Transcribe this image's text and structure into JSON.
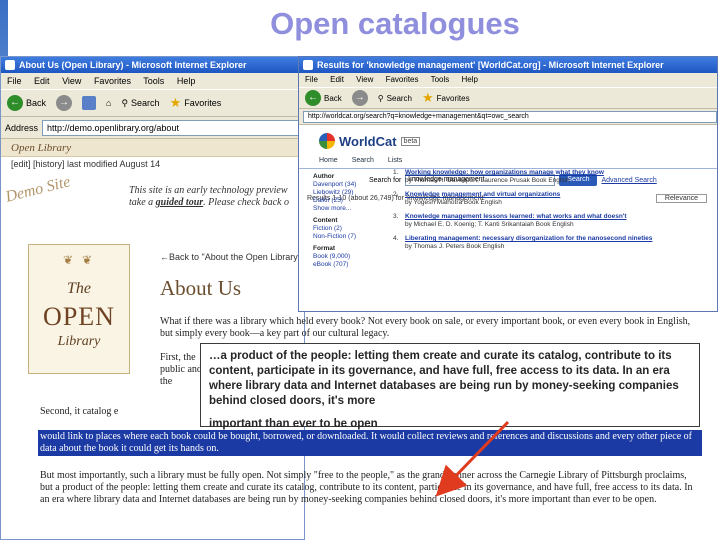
{
  "slide": {
    "title": "Open catalogues",
    "quote_main": "…a product of the people: letting them create and curate its catalog, contribute to its content, participate in its governance, and have full, free access to its data. In an era where library data and Internet databases are being run by money-seeking companies behind closed doors, it's more",
    "quote_last": "important than ever to be open"
  },
  "ie_left": {
    "title": "About Us (Open Library) - Microsoft Internet Explorer",
    "menu": [
      "File",
      "Edit",
      "View",
      "Favorites",
      "Tools",
      "Help"
    ],
    "toolbar": {
      "back": "Back",
      "search": "Search",
      "favorites": "Favorites"
    },
    "address_label": "Address",
    "address": "http://demo.openlibrary.org/about",
    "site_header": "Open Library",
    "edit_line": "[edit] [history] last modified August 14",
    "demo_stamp": "Demo Site",
    "demo_text_1": "This site is an early technology preview",
    "demo_text_2a": "take a ",
    "demo_text_2b": "guided tour",
    "demo_text_2c": ". Please check back o"
  },
  "open_library": {
    "logo_the": "The",
    "logo_open": "OPEN",
    "logo_library": "Library",
    "back_link": "←Back to \"About the Open Library\"",
    "page_title": "About Us",
    "p1": "What if there was a library which held every book? Not every book on sale, or every important book, or even every book in English, but simply every book—a key part of our cultural legacy.",
    "p2": "First, the public and all the",
    "p3": "Second, it catalog e",
    "highlight": "would link to places where each book could be bought, borrowed, or downloaded. It would collect reviews and references and discussions and every other piece of data about the book it could get its hands on.",
    "p4": "But most importantly, such a library must be fully open. Not simply \"free to the people,\" as the grand banner across the Carnegie Library of Pittsburgh proclaims, but a product of the people: letting them create and curate its catalog, contribute to its content, participate in its governance, and have full, free access to its data. In an era where library data and Internet databases are being run by money-seeking companies behind closed doors, it's more important than ever to be open."
  },
  "ie_right": {
    "title": "Results for 'knowledge management' [WorldCat.org] - Microsoft Internet Explorer",
    "menu": [
      "File",
      "Edit",
      "View",
      "Favorites",
      "Tools",
      "Help"
    ],
    "toolbar": {
      "back": "Back",
      "search": "Search",
      "favorites": "Favorites"
    },
    "address": "http://worldcat.org/search?q=knowledge+management&qt=owc_search",
    "logo": "WorldCat",
    "beta": "beta",
    "tabs": [
      "Home",
      "Search",
      "Lists"
    ],
    "search_label": "Search for",
    "search_value": "knowledge management",
    "search_button": "Search",
    "advanced_link": "Advanced Search",
    "results_label": "Results 1-10 (about 26,749) for 'knowledge management'",
    "sort_label": "Relevance",
    "facets": [
      {
        "head": "Author",
        "items": [
          "Davenport (34)",
          "Liebowitz (29)",
          "Dalkir (25)",
          "Show more..."
        ]
      },
      {
        "head": "Content",
        "items": [
          "Fiction (2)",
          "Non-Fiction (7)"
        ]
      },
      {
        "head": "Format",
        "items": [
          "Book (9,000)",
          "eBook (707)"
        ]
      }
    ],
    "results": [
      {
        "num": "1.",
        "title": "Working knowledge: how organizations manage what they know",
        "meta": "by Thomas H. Davenport; Laurence Prusak  Book  English"
      },
      {
        "num": "2.",
        "title": "Knowledge management and virtual organizations",
        "meta": "by Yogesh Malhotra  Book  English"
      },
      {
        "num": "3.",
        "title": "Knowledge management lessons learned: what works and what doesn't",
        "meta": "by Michael E. D. Koenig; T. Kanti Srikantaiah  Book  English"
      },
      {
        "num": "4.",
        "title": "Liberating management: necessary disorganization for the nanosecond nineties",
        "meta": "by Thomas J. Peters  Book  English"
      }
    ]
  }
}
